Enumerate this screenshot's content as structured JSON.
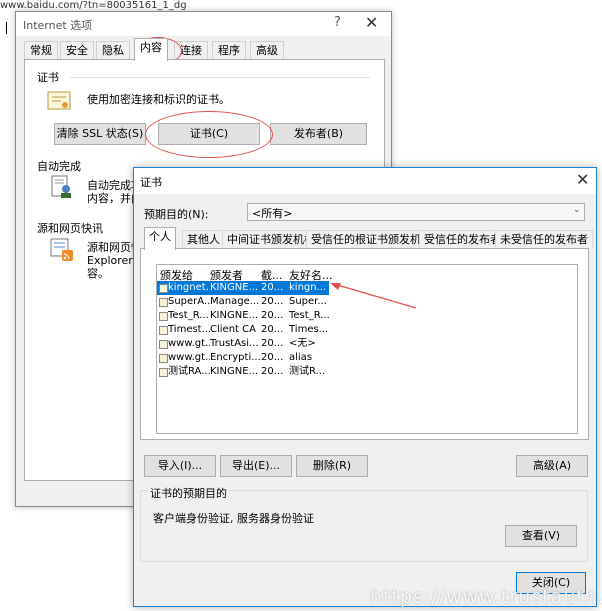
{
  "background": {
    "url_text": "www.baidu.com/?tn=80035161_1_dg"
  },
  "internet_options": {
    "title": "Internet 选项",
    "help_glyph": "?",
    "close_glyph": "✕",
    "tabs": [
      "常规",
      "安全",
      "隐私",
      "内容",
      "连接",
      "程序",
      "高级"
    ],
    "active_tab": "内容",
    "cert_group": {
      "label": "证书",
      "description": "使用加密连接和标识的证书。",
      "clear_ssl_button": "清除 SSL 状态(S)",
      "certs_button": "证书(C)",
      "publishers_button": "发布者(B)"
    },
    "autocomplete_group": {
      "label": "自动完成",
      "line1": "自动完成功",
      "line2": "内容，并向"
    },
    "feeds_group": {
      "label": "源和网页快讯",
      "line1": "源和网页快",
      "line2": "Explorer 和",
      "line3": "容。"
    }
  },
  "certificates": {
    "title": "证书",
    "close_glyph": "✕",
    "purpose_label": "预期目的(N):",
    "purpose_value": "<所有>",
    "tabs": [
      "个人",
      "其他人",
      "中间证书颁发机构",
      "受信任的根证书颁发机构",
      "受信任的发布者",
      "未受信任的发布者"
    ],
    "active_tab": "个人",
    "columns": [
      "颁发给",
      "颁发者",
      "截...",
      "友好名..."
    ],
    "rows": [
      {
        "issued_to": "kingnet...",
        "issuer": "KINGNE...",
        "date": "20...",
        "friendly": "kingn...",
        "selected": true
      },
      {
        "issued_to": "SuperA...",
        "issuer": "Manage...",
        "date": "20...",
        "friendly": "Super...",
        "selected": false
      },
      {
        "issued_to": "Test_R...",
        "issuer": "KINGNE...",
        "date": "20...",
        "friendly": "Test_R...",
        "selected": false
      },
      {
        "issued_to": "Timest...",
        "issuer": "Client CA",
        "date": "20...",
        "friendly": "Times...",
        "selected": false
      },
      {
        "issued_to": "www.gt...",
        "issuer": "TrustAsi...",
        "date": "20...",
        "friendly": "<无>",
        "selected": false
      },
      {
        "issued_to": "www.gt...",
        "issuer": "Encrypti...",
        "date": "20...",
        "friendly": "alias",
        "selected": false
      },
      {
        "issued_to": "测试RA...",
        "issuer": "KINGNE...",
        "date": "20...",
        "friendly": "测试R...",
        "selected": false
      }
    ],
    "buttons": {
      "import": "导入(I)...",
      "export": "导出(E)...",
      "remove": "删除(R)",
      "advanced": "高级(A)",
      "view": "查看(V)",
      "close": "关闭(C)"
    },
    "intended_purposes_label": "证书的预期目的",
    "intended_purposes_value": "客户端身份验证, 服务器身份验证"
  },
  "watermark": "https://www.trustauth.cn",
  "colors": {
    "selection": "#0078d7",
    "annotation": "#e05050",
    "dialog_border": "#1883d7"
  }
}
